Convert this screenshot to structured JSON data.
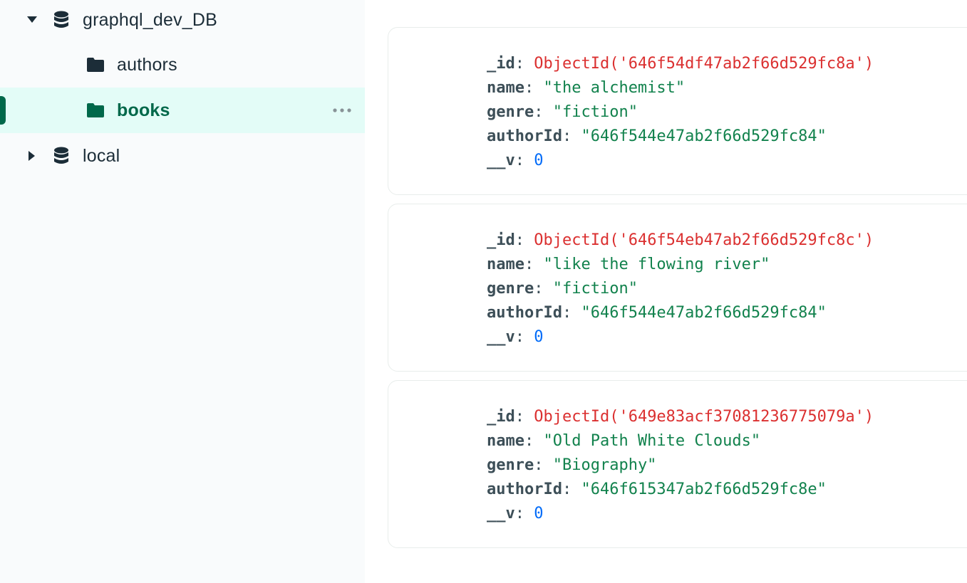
{
  "sidebar": {
    "databases": [
      {
        "name": "graphql_dev_DB",
        "expanded": true,
        "collections": [
          {
            "name": "authors",
            "active": false
          },
          {
            "name": "books",
            "active": true
          }
        ]
      },
      {
        "name": "local",
        "expanded": false
      }
    ]
  },
  "documents": [
    {
      "fields": [
        {
          "key": "_id",
          "value": "ObjectId('646f54df47ab2f66d529fc8a')",
          "type": "oid"
        },
        {
          "key": "name",
          "value": "\"the alchemist\"",
          "type": "str"
        },
        {
          "key": "genre",
          "value": "\"fiction\"",
          "type": "str"
        },
        {
          "key": "authorId",
          "value": "\"646f544e47ab2f66d529fc84\"",
          "type": "str"
        },
        {
          "key": "__v",
          "value": "0",
          "type": "num"
        }
      ]
    },
    {
      "fields": [
        {
          "key": "_id",
          "value": "ObjectId('646f54eb47ab2f66d529fc8c')",
          "type": "oid"
        },
        {
          "key": "name",
          "value": "\"like the flowing river\"",
          "type": "str"
        },
        {
          "key": "genre",
          "value": "\"fiction\"",
          "type": "str"
        },
        {
          "key": "authorId",
          "value": "\"646f544e47ab2f66d529fc84\"",
          "type": "str"
        },
        {
          "key": "__v",
          "value": "0",
          "type": "num"
        }
      ]
    },
    {
      "fields": [
        {
          "key": "_id",
          "value": "ObjectId('649e83acf37081236775079a')",
          "type": "oid"
        },
        {
          "key": "name",
          "value": "\"Old Path White Clouds\"",
          "type": "str"
        },
        {
          "key": "genre",
          "value": "\"Biography\"",
          "type": "str"
        },
        {
          "key": "authorId",
          "value": "\"646f615347ab2f66d529fc8e\"",
          "type": "str"
        },
        {
          "key": "__v",
          "value": "0",
          "type": "num"
        }
      ]
    }
  ],
  "colors": {
    "accent": "#00684a",
    "active_bg": "#e3fcf7",
    "objectid": "#db3030",
    "string": "#12824d",
    "number": "#016bf8",
    "key": "#3d4f58"
  },
  "icons": {
    "expanded_caret": "caret-down-icon",
    "collapsed_caret": "caret-right-icon",
    "database": "database-icon",
    "collection": "folder-icon",
    "more": "more-options-icon"
  }
}
